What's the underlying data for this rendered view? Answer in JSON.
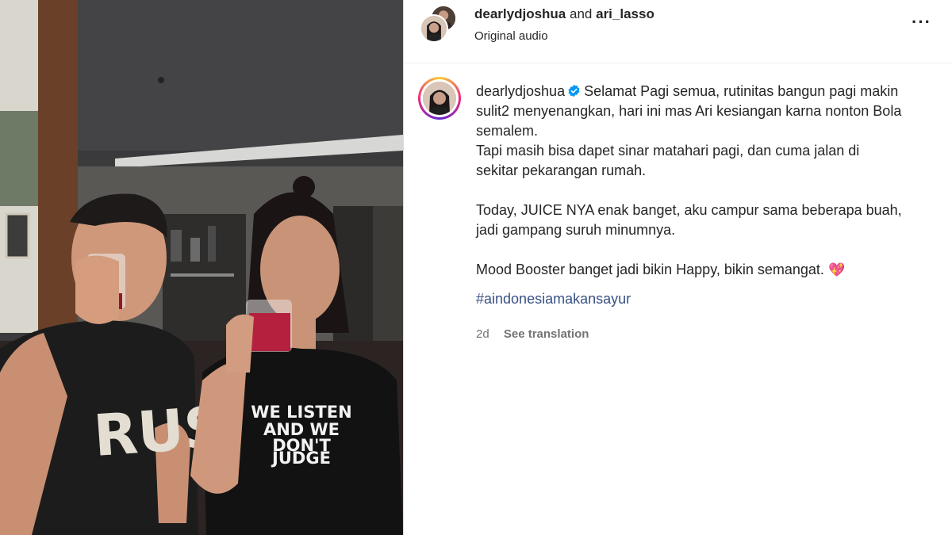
{
  "header": {
    "user1": "dearlydjoshua",
    "and_text": "and",
    "user2": "ari_lasso",
    "audio": "Original audio",
    "more_icon": "more-horizontal-icon"
  },
  "video": {
    "shirt_left": "RUSH",
    "shirt_right_line1": "WE LISTEN",
    "shirt_right_line2": "AND WE",
    "shirt_right_line3": "DON'T",
    "shirt_right_line4": "JUDGE"
  },
  "caption": {
    "username": "dearlydjoshua",
    "paragraph1": "Selamat Pagi semua, rutinitas bangun pagi makin sulit2 menyenangkan, hari ini mas Ari kesiangan karna nonton Bola semalem.",
    "paragraph2": "Tapi masih bisa dapet sinar matahari pagi, dan cuma jalan di sekitar pekarangan rumah.",
    "paragraph3": "Today, JUICE NYA enak banget, aku campur sama beberapa buah, jadi gampang suruh minumnya.",
    "paragraph4": "Mood Booster banget jadi bikin Happy, bikin semangat.",
    "emoji": "💖",
    "hashtag": "#aindonesiamakansayur"
  },
  "meta": {
    "time": "2d",
    "translate": "See translation"
  },
  "colors": {
    "link": "#385185",
    "verified": "#0095f6",
    "muted": "#737373"
  }
}
